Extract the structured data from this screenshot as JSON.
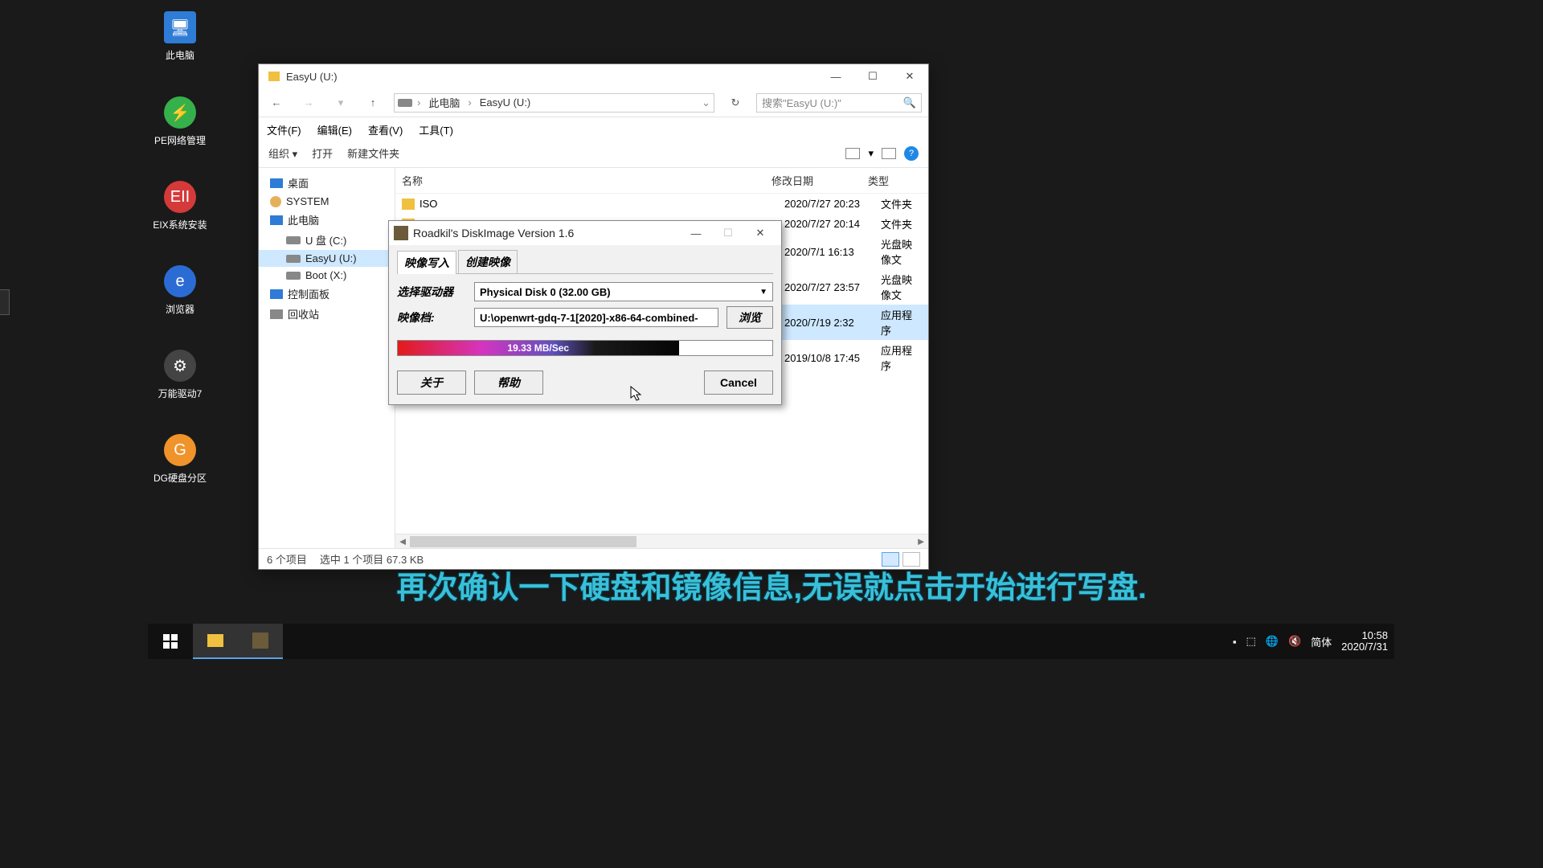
{
  "desktop": {
    "icons": [
      {
        "label": "此电脑",
        "color": "#2e7cd6"
      },
      {
        "label": "PE网络管理",
        "color": "#36b04a"
      },
      {
        "label": "EIX系统安装",
        "color": "#d43a3a"
      },
      {
        "label": "浏览器",
        "color": "#2b6cd4"
      },
      {
        "label": "万能驱动7",
        "color": "#444444"
      },
      {
        "label": "DG硬盘分区",
        "color": "#f0932b"
      }
    ]
  },
  "explorer": {
    "title": "EasyU (U:)",
    "breadcrumb": {
      "pc": "此电脑",
      "drive": "EasyU (U:)"
    },
    "search_placeholder": "搜索\"EasyU (U:)\"",
    "menu": {
      "file": "文件(F)",
      "edit": "编辑(E)",
      "view": "查看(V)",
      "tools": "工具(T)"
    },
    "toolbar": {
      "organize": "组织 ▾",
      "open": "打开",
      "newfolder": "新建文件夹"
    },
    "tree": {
      "desktop": "桌面",
      "system": "SYSTEM",
      "pc": "此电脑",
      "drv_c": "U 盘 (C:)",
      "drv_u": "EasyU (U:)",
      "drv_x": "Boot (X:)",
      "cpl": "控制面板",
      "recycle": "回收站"
    },
    "columns": {
      "name": "名称",
      "date": "修改日期",
      "type": "类型"
    },
    "rows": [
      {
        "name": "ISO",
        "date": "2020/7/27 20:23",
        "type": "文件夹",
        "kind": "folder"
      },
      {
        "name": "",
        "date": "2020/7/27 20:14",
        "type": "文件夹",
        "kind": "folder"
      },
      {
        "name": "",
        "date": "2020/7/1 16:13",
        "type": "光盘映像文",
        "kind": "img"
      },
      {
        "name": "",
        "date": "2020/7/27 23:57",
        "type": "光盘映像文",
        "kind": "img"
      },
      {
        "name": "",
        "date": "2020/7/19 2:32",
        "type": "应用程序",
        "kind": "app",
        "selected": true
      },
      {
        "name": "",
        "date": "2019/10/8 17:45",
        "type": "应用程序",
        "kind": "app"
      }
    ],
    "status": {
      "items": "6 个项目",
      "selected": "选中 1 个项目  67.3 KB"
    }
  },
  "dialog": {
    "title": "Roadkil's DiskImage Version 1.6",
    "tab_write": "映像写入",
    "tab_create": "创建映像",
    "drive_label": "选择驱动器",
    "drive_value": "Physical Disk 0 (32.00 GB)",
    "file_label": "映像档:",
    "file_value": "U:\\openwrt-gdq-7-1[2020]-x86-64-combined-",
    "browse": "浏览",
    "progress_text": "19.33 MB/Sec",
    "about": "关于",
    "help": "帮助",
    "cancel": "Cancel"
  },
  "subtitle": "再次确认一下硬盘和镜像信息,无误就点击开始进行写盘.",
  "taskbar": {
    "lang": "简体",
    "time": "10:58",
    "date": "2020/7/31"
  }
}
